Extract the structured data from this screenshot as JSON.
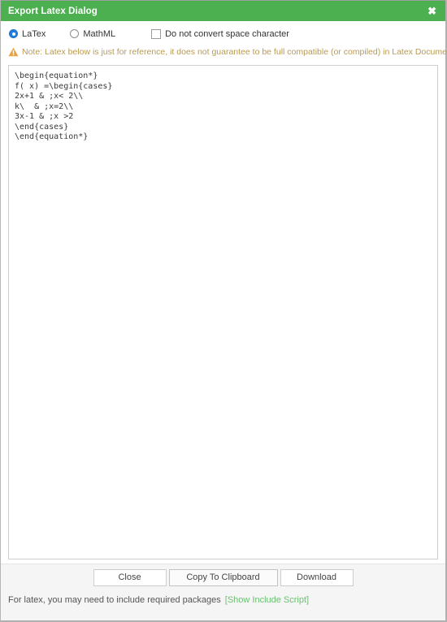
{
  "dialog": {
    "title": "Export Latex Dialog",
    "close_icon": "close-icon",
    "close_glyph": "✖"
  },
  "options": {
    "latex": {
      "label": "LaTex",
      "selected": true
    },
    "mathml": {
      "label": "MathML",
      "selected": false
    },
    "no_space_convert": {
      "label": "Do not convert space character",
      "checked": false
    }
  },
  "note": {
    "icon": "warning-triangle-icon",
    "text": "Note: Latex below is just for reference, it does not guarantee to be full compatible (or compiled) in Latex Document."
  },
  "editor": {
    "content": "\\begin{equation*}\nf( x) =\\begin{cases}\n2x+1 & ;x< 2\\\\\nk\\  & ;x=2\\\\\n3x-1 & ;x >2\n\\end{cases}\n\\end{equation*}"
  },
  "buttons": {
    "close": "Close",
    "copy": "Copy To Clipboard",
    "download": "Download"
  },
  "footer": {
    "text": "For latex, you may need to include required packages",
    "link": "[Show Include Script]"
  },
  "colors": {
    "titlebar_green": "#4cb050",
    "link_green": "#6cbf73",
    "note_amber": "#b99a52",
    "radio_blue": "#1e7fe0"
  }
}
